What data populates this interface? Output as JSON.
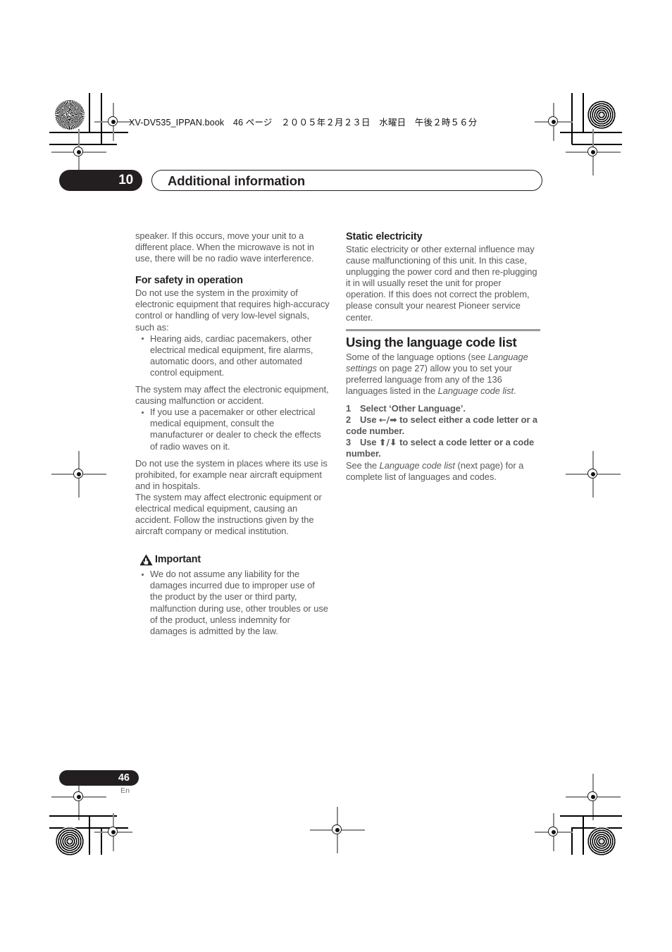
{
  "print_marks": {
    "file_info": "XV-DV535_IPPAN.book　46 ページ　２００５年２月２３日　水曜日　午後２時５６分"
  },
  "chapter": {
    "number": "10",
    "title": "Additional information"
  },
  "left_column": {
    "intro_paragraph": "speaker. If this occurs, move your unit to a different place. When the microwave is not in use, there will be no radio wave interference.",
    "safety_heading": "For safety in operation",
    "safety_intro": "Do not use the system in the proximity of electronic equipment that requires high-accuracy control or handling of very low-level signals, such as:",
    "safety_bullets_1": [
      "Hearing aids, cardiac pacemakers, other electrical medical equipment, fire alarms, automatic doors, and other automated control equipment."
    ],
    "safety_note_1": "The system may affect the electronic equipment, causing malfunction or accident.",
    "safety_bullets_2": [
      "If you use a pacemaker or other electrical medical equipment, consult the manufacturer or dealer to check the effects of radio waves on it."
    ],
    "safety_note_2": "Do not use the system in places where its use is prohibited, for example near aircraft equipment and in hospitals.",
    "safety_note_3": "The system may affect electronic equipment or electrical medical equipment, causing an accident. Follow the instructions given by the aircraft company or medical institution.",
    "important_label": "Important",
    "important_bullets": [
      "We do not assume any liability for the damages incurred due to improper use of the product by the user or third party, malfunction during use, other troubles or use of the product, unless indemnity for damages is admitted by the law."
    ]
  },
  "right_column": {
    "static_heading": "Static electricity",
    "static_paragraph": "Static electricity or other external influence may cause malfunctioning of this unit. In this case, unplugging the power cord and then re-plugging it in will usually reset the unit for proper operation. If this does not correct the problem, please consult your nearest Pioneer service center.",
    "language_heading": "Using the language code list",
    "language_intro_a": "Some of the language options (see ",
    "language_intro_italic_1": "Language settings",
    "language_intro_b": " on page 27) allow you to set your preferred language from any of the 136 languages listed in the ",
    "language_intro_italic_2": "Language code list",
    "language_intro_c": ".",
    "steps": [
      {
        "num": "1",
        "text": "Select ‘Other Language’."
      },
      {
        "num": "2",
        "text_before": "Use ",
        "arrows": "←/➡",
        "text_after": " to select either a code letter or a code number."
      },
      {
        "num": "3",
        "text_before": "Use ",
        "arrows": "⬆/⬇",
        "text_after": " to select a code letter or a code number."
      }
    ],
    "see_also_a": "See the ",
    "see_also_italic": "Language code list",
    "see_also_b": " (next page) for a complete list of languages and codes."
  },
  "footer": {
    "page_number": "46",
    "language_code": "En"
  },
  "colors": {
    "ink_black": "#231f20",
    "body_grey": "#58585a",
    "rule_grey": "#9a9a9a",
    "paper_white": "#ffffff"
  }
}
